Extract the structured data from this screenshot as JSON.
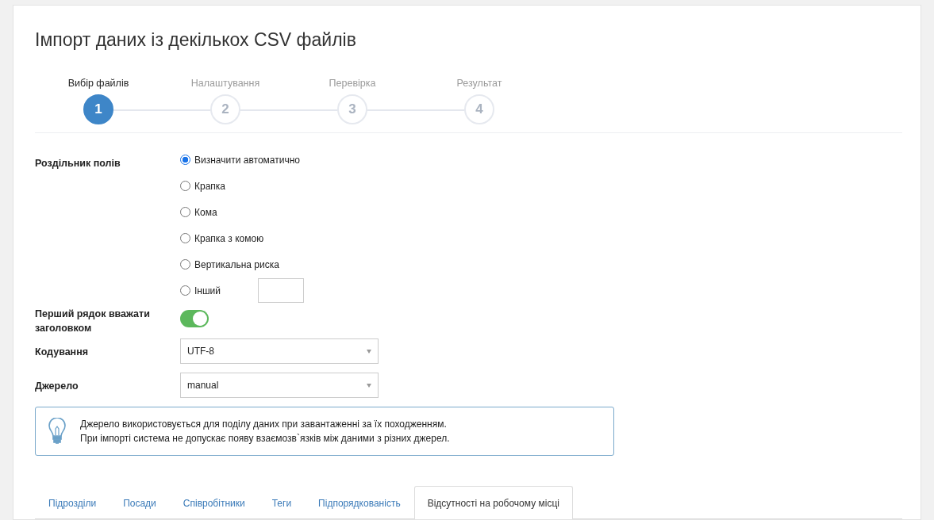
{
  "title": "Імпорт даних із декількох CSV файлів",
  "steps": [
    {
      "number": "1",
      "label": "Вибір файлів",
      "selected": true
    },
    {
      "number": "2",
      "label": "Налаштування",
      "selected": false
    },
    {
      "number": "3",
      "label": "Перевірка",
      "selected": false
    },
    {
      "number": "4",
      "label": "Результат",
      "selected": false
    }
  ],
  "fields": [
    {
      "kind": "radio-group",
      "label": "Роздільник полів",
      "options": [
        {
          "kind": "plain",
          "label": "Визначити автоматично",
          "selected": true
        },
        {
          "kind": "plain",
          "label": "Крапка",
          "selected": false
        },
        {
          "kind": "plain",
          "label": "Кома",
          "selected": false
        },
        {
          "kind": "plain",
          "label": "Крапка з комою",
          "selected": false
        },
        {
          "kind": "plain",
          "label": "Вертикальна риска",
          "selected": false
        },
        {
          "kind": "with-input",
          "label": "Інший",
          "selected": false
        }
      ]
    },
    {
      "kind": "toggle",
      "label": "Перший рядок вважати заголовком",
      "on": true
    },
    {
      "kind": "select",
      "label": "Кодування",
      "value": "UTF-8"
    },
    {
      "kind": "select",
      "label": "Джерело",
      "value": "manual"
    }
  ],
  "info": {
    "lines": [
      "Джерело використовується для поділу даних при завантаженні за їх походженням.",
      "При імпорті система не допускає появу взаємозв`язків між даними з різних джерел."
    ]
  },
  "tabs": [
    {
      "label": "Підрозділи",
      "selected": false
    },
    {
      "label": "Посади",
      "selected": false
    },
    {
      "label": "Співробітники",
      "selected": false
    },
    {
      "label": "Теги",
      "selected": false
    },
    {
      "label": "Підпорядкованість",
      "selected": false
    },
    {
      "label": "Відсутності на робочому місці",
      "selected": true
    }
  ]
}
